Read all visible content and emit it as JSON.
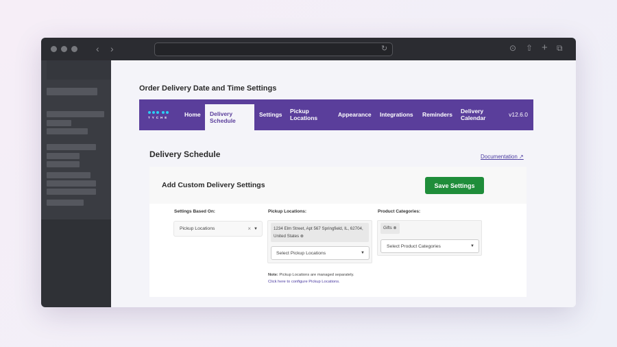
{
  "page": {
    "title": "Order Delivery Date and Time Settings"
  },
  "nav": {
    "logo": "TYCHE",
    "items": [
      "Home",
      "Delivery Schedule",
      "Settings",
      "Pickup Locations",
      "Appearance",
      "Integrations",
      "Reminders",
      "Delivery Calendar"
    ],
    "active": "Delivery Schedule",
    "version": "v12.6.0"
  },
  "section": {
    "title": "Delivery Schedule",
    "doc_link": "Documentation"
  },
  "card": {
    "title": "Add Custom Delivery Settings",
    "save_label": "Save Settings",
    "settings_based_on": {
      "label": "Settings Based On:",
      "value": "Pickup Locations"
    },
    "pickup": {
      "label": "Pickup Locations:",
      "tag": "1234 Elm Street, Apt 567 Springfield, IL, 62704, United States",
      "placeholder": "Select Pickup Locations"
    },
    "categories": {
      "label": "Product Categories:",
      "tag": "Gifts",
      "placeholder": "Select Product Categories"
    },
    "note": {
      "prefix": "Note:",
      "text": " Pickup Locations are managed separately.",
      "link": "Click here to configure Pickup Locations."
    }
  },
  "colors": {
    "nav": "#5a3e9b",
    "save": "#1f8d3a"
  }
}
